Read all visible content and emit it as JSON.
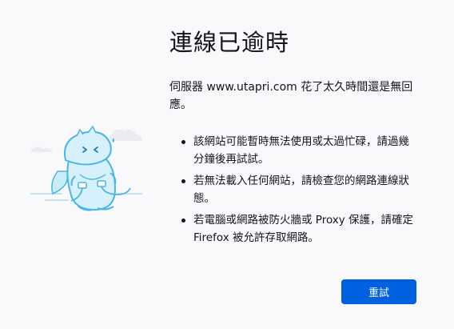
{
  "page": {
    "title": "連線已逾時",
    "description": "伺服器 www.utapri.com 花了太久時間還是無回應。",
    "tips": [
      "該網站可能暫時無法使用或太過忙碌，請過幾分鐘後再試試。",
      "若無法載入任何網站，請檢查您的網路連線狀態。",
      "若電腦或網路被防火牆或 Proxy 保護，請確定 Firefox 被允許存取網路。"
    ],
    "retry_label": "重試"
  },
  "illustration": {
    "icon": "dinosaur-unplugged-illustration",
    "colors": {
      "body": "#d6f1fb",
      "outline": "#4ab6e6",
      "cloud": "#ececf0"
    }
  },
  "colors": {
    "background": "#f9f9fb",
    "text": "#15141a",
    "button": "#0061e0",
    "button_text": "#ffffff"
  }
}
